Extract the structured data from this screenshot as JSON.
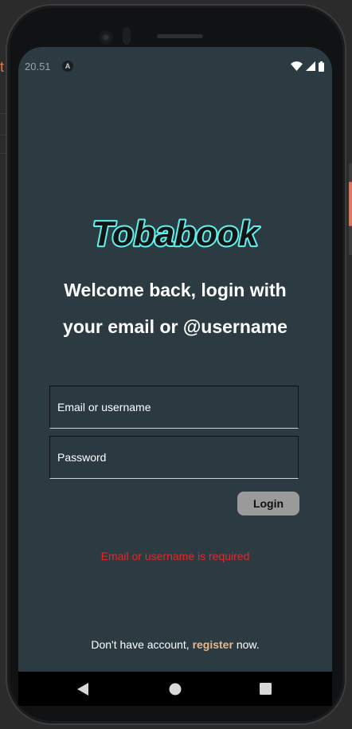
{
  "status_bar": {
    "time": "20.51",
    "notification_glyph": "A",
    "icons": [
      "wifi-icon",
      "signal-icon",
      "battery-icon"
    ]
  },
  "app": {
    "logo_text": "Tobabook",
    "welcome_line1": "Welcome back, login with",
    "welcome_line2": "your email or @username"
  },
  "form": {
    "email_placeholder": "Email or username",
    "email_value": "",
    "password_placeholder": "Password",
    "password_value": "",
    "login_label": "Login",
    "error_message": "Email or username is required"
  },
  "footer": {
    "prefix": "Don't have account,",
    "register_label": "register",
    "suffix": "now."
  },
  "navigation_bar": {
    "buttons": [
      "back-icon",
      "home-icon",
      "recents-icon"
    ]
  },
  "colors": {
    "screen_background": "#2c3a42",
    "logo_fill": "#141414",
    "logo_outline": "#5ef2ee",
    "error": "#e12a2a",
    "register_link": "#e8b88a",
    "button_background": "#9a9a9a"
  }
}
